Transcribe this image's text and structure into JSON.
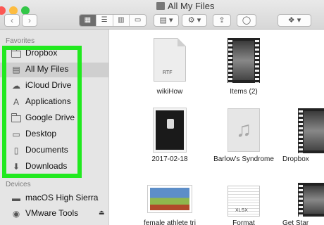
{
  "window": {
    "title": "All My Files",
    "traffic_light_colors": [
      "#fc5753",
      "#fdbc40",
      "#33c748"
    ],
    "selection_highlight_color": "#21e91f"
  },
  "toolbar": {
    "back_glyph": "‹",
    "forward_glyph": "›",
    "view_modes": [
      "icon-view",
      "list-view",
      "column-view",
      "cover-flow-view"
    ],
    "arrange_icon": "arrange-icon",
    "action_icon": "gear-icon",
    "share_icon": "share-icon",
    "tag_icon": "tag-icon",
    "dropbox_icon": "dropbox-icon",
    "chevron_glyph": "▾"
  },
  "sidebar": {
    "favorites_label": "Favorites",
    "favorites": [
      {
        "label": "Dropbox",
        "icon": "folder-icon"
      },
      {
        "label": "All My Files",
        "icon": "all-files-icon",
        "selected": true
      },
      {
        "label": "iCloud Drive",
        "icon": "cloud-icon"
      },
      {
        "label": "Applications",
        "icon": "applications-icon"
      },
      {
        "label": "Google Drive",
        "icon": "folder-icon"
      },
      {
        "label": "Desktop",
        "icon": "desktop-icon"
      },
      {
        "label": "Documents",
        "icon": "documents-icon"
      },
      {
        "label": "Downloads",
        "icon": "downloads-icon"
      }
    ],
    "devices_label": "Devices",
    "devices": [
      {
        "label": "macOS High Sierra",
        "icon": "hard-drive-icon"
      },
      {
        "label": "VMware Tools",
        "icon": "disk-icon",
        "eject": "⏏"
      }
    ]
  },
  "files": [
    {
      "name": "wikiHow",
      "kind": "rtf-document",
      "ext": "RTF"
    },
    {
      "name": "Items (2)",
      "kind": "movie"
    },
    {
      "name": "2017-02-18",
      "kind": "photo"
    },
    {
      "name": "Barlow's Syndrome",
      "kind": "music"
    },
    {
      "name": "Dropbox",
      "kind": "movie"
    },
    {
      "name": "female athlete tri",
      "kind": "image"
    },
    {
      "name": "Format",
      "kind": "spreadsheet",
      "ext": "XLSX"
    },
    {
      "name": "Get Star",
      "kind": "movie"
    }
  ]
}
